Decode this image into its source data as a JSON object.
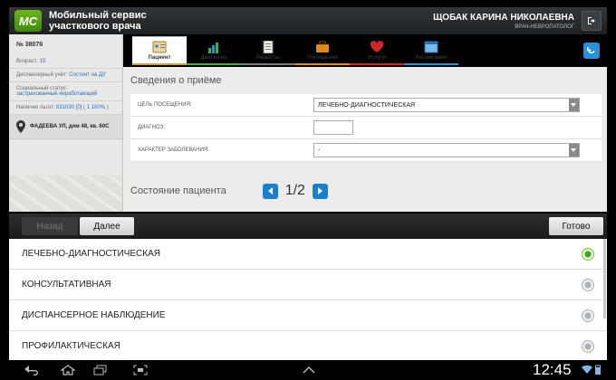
{
  "header": {
    "logo_text": "МС",
    "title": "Мобильный сервис участкового врача",
    "user_name": "ЩОБАК КАРИНА НИКОЛАЕВНА",
    "user_role": "ВРАЧ-НЕВРОПАТОЛОГ",
    "logout_icon": "logout-icon"
  },
  "patient_panel": {
    "card_number": "№ 38076",
    "age_label": "Возраст:",
    "age_value": "15",
    "dispensary_label": "Диспансерный учёт:",
    "dispensary_value": "Состоит на ДУ",
    "social_label": "Социальный статус:",
    "social_value": "застрахованный неработающий",
    "benefits_label": "Наличие льгот:",
    "benefits_value": "631030 [0] ( 1 100% )",
    "address": "ФАДЕЕВА УЛ, дом 48, кв. 60С"
  },
  "tabs": [
    {
      "label": "Пациент",
      "icon": "patient-card-icon",
      "color": "#c9a24a",
      "active": true
    },
    {
      "label": "Диагнозы",
      "icon": "bar-chart-icon",
      "color": "#49a84a",
      "active": false
    },
    {
      "label": "Рецепты",
      "icon": "prescription-icon",
      "color": "#7a7a7a",
      "active": false
    },
    {
      "label": "Посещения",
      "icon": "briefcase-icon",
      "color": "#e08a1e",
      "active": false
    },
    {
      "label": "Услуги",
      "icon": "heart-icon",
      "color": "#d0262a",
      "active": false
    },
    {
      "label": "Расписание",
      "icon": "schedule-icon",
      "color": "#2a8fd6",
      "active": false
    }
  ],
  "visit": {
    "section_title": "Сведения о приёме",
    "purpose_label": "ЦЕЛЬ ПОСЕЩЕНИЯ:",
    "purpose_value": "ЛЕЧЕБНО-ДИАГНОСТИЧЕСКАЯ",
    "diagnosis_label": "ДИАГНОЗ:",
    "nature_label": "ХАРАКТЕР ЗАБОЛЕВАНИЯ:",
    "nature_value": "-",
    "state_label": "Состояние пациента",
    "page": "1/2"
  },
  "picker": {
    "back_label": "Назад",
    "next_label": "Далее",
    "done_label": "Готово",
    "options": [
      {
        "label": "ЛЕЧЕБНО-ДИАГНОСТИЧЕСКАЯ",
        "selected": true
      },
      {
        "label": "КОНСУЛЬТАТИВНАЯ",
        "selected": false
      },
      {
        "label": "ДИСПАНСЕРНОЕ НАБЛЮДЕНИЕ",
        "selected": false
      },
      {
        "label": "ПРОФИЛАКТИЧЕСКАЯ",
        "selected": false
      }
    ]
  },
  "system_bar": {
    "time": "12:45",
    "accent": "#7fb8e6"
  }
}
